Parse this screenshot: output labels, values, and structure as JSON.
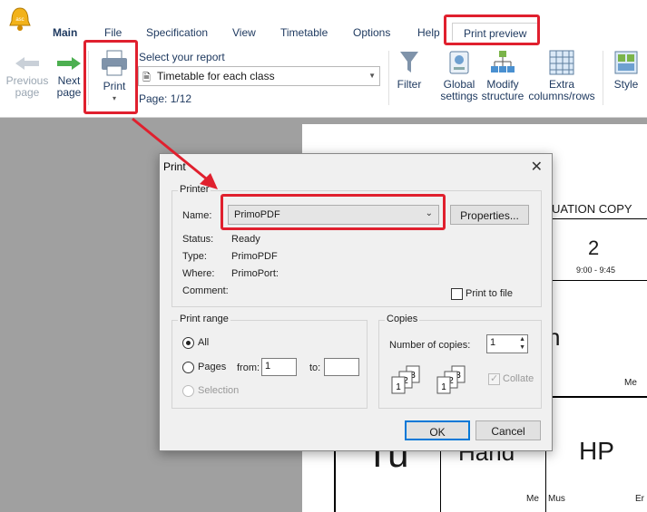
{
  "tabs": {
    "main": "Main",
    "file": "File",
    "specification": "Specification",
    "view": "View",
    "timetable": "Timetable",
    "options": "Options",
    "help": "Help",
    "print_preview": "Print preview"
  },
  "ribbon": {
    "previous_line1": "Previous",
    "previous_line2": "page",
    "next_line1": "Next",
    "next_line2": "page",
    "print": "Print",
    "select_report_label": "Select your report",
    "report_value": "Timetable for each class",
    "page_info": "Page: 1/12",
    "filter": "Filter",
    "global_line1": "Global",
    "global_line2": "settings",
    "modify_line1": "Modify",
    "modify_line2": "structure",
    "extra_line1": "Extra",
    "extra_line2": "columns/rows",
    "style": "Style"
  },
  "paper": {
    "eval_text": "UATION COPY",
    "period_num": "2",
    "period_time": "9:00 - 9:45",
    "cell_h": "h",
    "cell_me1": "Me",
    "cell_tu": "Tu",
    "cell_hand": "Hand",
    "cell_hp": "HP",
    "cell_me2": "Me",
    "cell_mus": "Mus",
    "cell_er": "Er"
  },
  "dialog": {
    "title": "Print",
    "printer_group": "Printer",
    "name_label": "Name:",
    "printer_name": "PrimoPDF",
    "properties_button": "Properties...",
    "status_label": "Status:",
    "status_value": "Ready",
    "type_label": "Type:",
    "type_value": "PrimoPDF",
    "where_label": "Where:",
    "where_value": "PrimoPort:",
    "comment_label": "Comment:",
    "print_to_file": "Print to file",
    "range_group": "Print range",
    "range_all": "All",
    "range_pages": "Pages",
    "from_label": "from:",
    "from_value": "1",
    "to_label": "to:",
    "to_value": "",
    "range_selection": "Selection",
    "copies_group": "Copies",
    "num_copies_label": "Number of copies:",
    "num_copies_value": "1",
    "collate": "Collate",
    "ok_button": "OK",
    "cancel_button": "Cancel"
  },
  "colors": {
    "highlight": "#e0202e",
    "accent": "#0078d7",
    "ribbon_text": "#1f3a60"
  }
}
